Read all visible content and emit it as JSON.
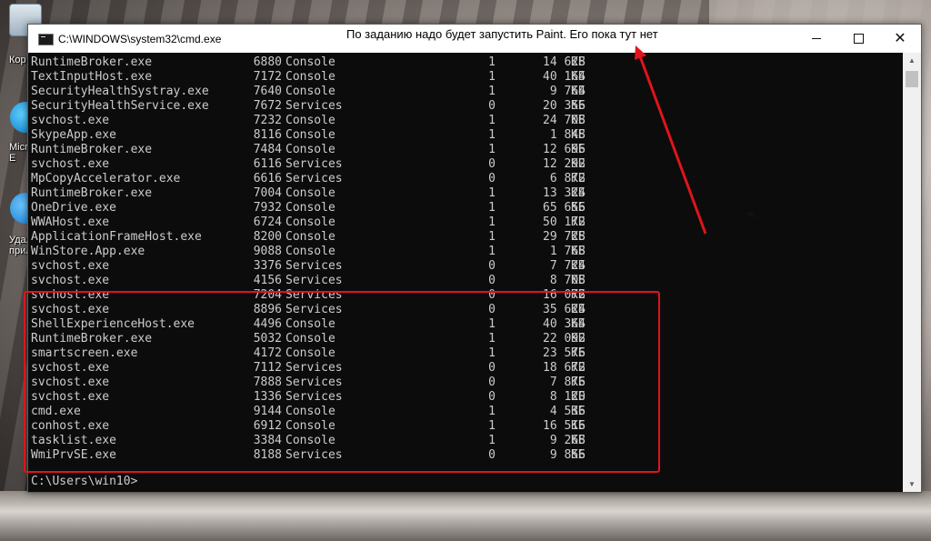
{
  "desktop": {
    "icons": [
      {
        "name": "recycle-bin",
        "label": "Кор"
      },
      {
        "name": "edge",
        "label": "Micr\nE"
      },
      {
        "name": "rdp",
        "label": "Удал\nприл"
      }
    ]
  },
  "window": {
    "title": "C:\\WINDOWS\\system32\\cmd.exe",
    "annotation": "По заданию надо будет запустить Paint. Его пока тут нет",
    "buttons": {
      "minimize": "minimize",
      "maximize": "maximize",
      "close": "close"
    }
  },
  "processes": [
    {
      "name": "RuntimeBroker.exe",
      "pid": "6880",
      "session": "Console",
      "num": "1",
      "mem": "14 628",
      "unit": "КБ"
    },
    {
      "name": "TextInputHost.exe",
      "pid": "7172",
      "session": "Console",
      "num": "1",
      "mem": "40 164",
      "unit": "КБ"
    },
    {
      "name": "SecurityHealthSystray.exe",
      "pid": "7640",
      "session": "Console",
      "num": "1",
      "mem": "9 764",
      "unit": "КБ"
    },
    {
      "name": "SecurityHealthService.exe",
      "pid": "7672",
      "session": "Services",
      "num": "0",
      "mem": "20 356",
      "unit": "КБ"
    },
    {
      "name": "svchost.exe",
      "pid": "7232",
      "session": "Console",
      "num": "1",
      "mem": "24 708",
      "unit": "КБ"
    },
    {
      "name": "SkypeApp.exe",
      "pid": "8116",
      "session": "Console",
      "num": "1",
      "mem": "1 848",
      "unit": "КБ"
    },
    {
      "name": "RuntimeBroker.exe",
      "pid": "7484",
      "session": "Console",
      "num": "1",
      "mem": "12 696",
      "unit": "КБ"
    },
    {
      "name": "svchost.exe",
      "pid": "6116",
      "session": "Services",
      "num": "0",
      "mem": "12 292",
      "unit": "КБ"
    },
    {
      "name": "MpCopyAccelerator.exe",
      "pid": "6616",
      "session": "Services",
      "num": "0",
      "mem": "6 872",
      "unit": "КБ"
    },
    {
      "name": "RuntimeBroker.exe",
      "pid": "7004",
      "session": "Console",
      "num": "1",
      "mem": "13 324",
      "unit": "КБ"
    },
    {
      "name": "OneDrive.exe",
      "pid": "7932",
      "session": "Console",
      "num": "1",
      "mem": "65 656",
      "unit": "КБ"
    },
    {
      "name": "WWAHost.exe",
      "pid": "6724",
      "session": "Console",
      "num": "1",
      "mem": "50 172",
      "unit": "КБ"
    },
    {
      "name": "ApplicationFrameHost.exe",
      "pid": "8200",
      "session": "Console",
      "num": "1",
      "mem": "29 728",
      "unit": "КБ"
    },
    {
      "name": "WinStore.App.exe",
      "pid": "9088",
      "session": "Console",
      "num": "1",
      "mem": "1 768",
      "unit": "КБ"
    },
    {
      "name": "svchost.exe",
      "pid": "3376",
      "session": "Services",
      "num": "0",
      "mem": "7 724",
      "unit": "КБ"
    },
    {
      "name": "svchost.exe",
      "pid": "4156",
      "session": "Services",
      "num": "0",
      "mem": "8 708",
      "unit": "КБ"
    },
    {
      "name": "svchost.exe",
      "pid": "7204",
      "session": "Services",
      "num": "0",
      "mem": "16 072",
      "unit": "КБ"
    },
    {
      "name": "svchost.exe",
      "pid": "8896",
      "session": "Services",
      "num": "0",
      "mem": "35 624",
      "unit": "КБ"
    },
    {
      "name": "ShellExperienceHost.exe",
      "pid": "4496",
      "session": "Console",
      "num": "1",
      "mem": "40 364",
      "unit": "КБ"
    },
    {
      "name": "RuntimeBroker.exe",
      "pid": "5032",
      "session": "Console",
      "num": "1",
      "mem": "22 092",
      "unit": "КБ"
    },
    {
      "name": "smartscreen.exe",
      "pid": "4172",
      "session": "Console",
      "num": "1",
      "mem": "23 576",
      "unit": "КБ"
    },
    {
      "name": "svchost.exe",
      "pid": "7112",
      "session": "Services",
      "num": "0",
      "mem": "18 672",
      "unit": "КБ"
    },
    {
      "name": "svchost.exe",
      "pid": "7888",
      "session": "Services",
      "num": "0",
      "mem": "7 876",
      "unit": "КБ"
    },
    {
      "name": "svchost.exe",
      "pid": "1336",
      "session": "Services",
      "num": "0",
      "mem": "8 120",
      "unit": "КБ"
    },
    {
      "name": "cmd.exe",
      "pid": "9144",
      "session": "Console",
      "num": "1",
      "mem": "4 536",
      "unit": "КБ"
    },
    {
      "name": "conhost.exe",
      "pid": "6912",
      "session": "Console",
      "num": "1",
      "mem": "16 516",
      "unit": "КБ"
    },
    {
      "name": "tasklist.exe",
      "pid": "3384",
      "session": "Console",
      "num": "1",
      "mem": "9 268",
      "unit": "КБ"
    },
    {
      "name": "WmiPrvSE.exe",
      "pid": "8188",
      "session": "Services",
      "num": "0",
      "mem": "9 856",
      "unit": "КБ"
    }
  ],
  "prompt": "C:\\Users\\win10>",
  "colors": {
    "highlight": "#e0141c",
    "console_bg": "#0c0c0c",
    "console_fg": "#cccccc"
  }
}
